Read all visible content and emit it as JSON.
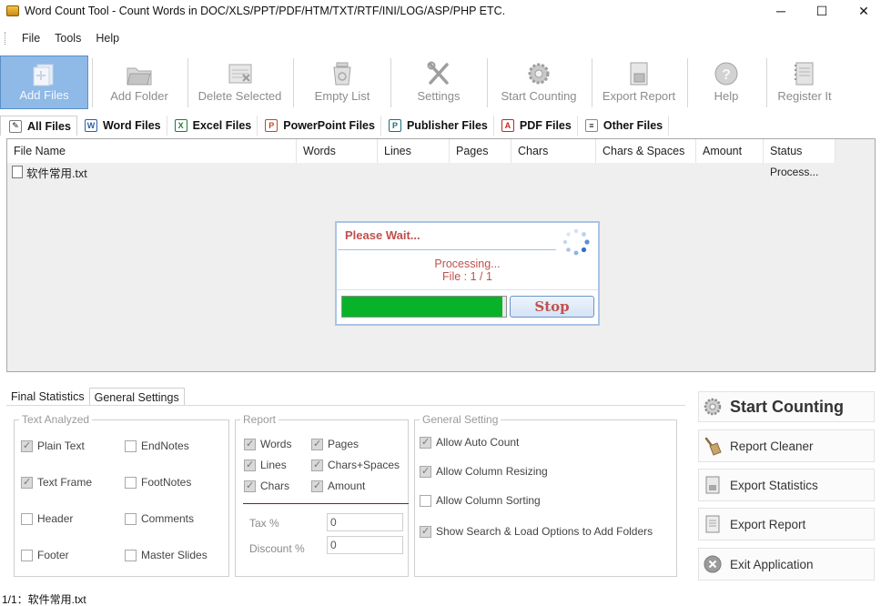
{
  "window": {
    "title": "Word Count Tool - Count Words in DOC/XLS/PPT/PDF/HTM/TXT/RTF/INI/LOG/ASP/PHP ETC.",
    "minimize": "─",
    "maximize": "☐",
    "close": "✕"
  },
  "menu": {
    "items": [
      "File",
      "Tools",
      "Help"
    ]
  },
  "toolbar": {
    "add_files": "Add Files",
    "add_folder": "Add Folder",
    "delete_selected": "Delete Selected",
    "empty_list": "Empty List",
    "settings": "Settings",
    "start_counting": "Start Counting",
    "export_report": "Export Report",
    "help": "Help",
    "register_it": "Register It"
  },
  "category_tabs": {
    "all": "All Files",
    "word": "Word Files",
    "excel": "Excel Files",
    "powerpoint": "PowerPoint Files",
    "publisher": "Publisher Files",
    "pdf": "PDF Files",
    "other": "Other Files"
  },
  "file_list": {
    "columns": [
      "File Name",
      "Words",
      "Lines",
      "Pages",
      "Chars",
      "Chars & Spaces",
      "Amount",
      "Status"
    ],
    "rows": [
      {
        "file_name": "软件常用.txt",
        "status": "Process..."
      }
    ]
  },
  "wait_dialog": {
    "title": "Please Wait...",
    "processing": "Processing...",
    "file_progress": "File : 1 / 1",
    "progress_fraction": 0.98,
    "stop_label": "Stop"
  },
  "bottom_tabs": {
    "final_statistics": "Final Statistics",
    "general_settings": "General Settings"
  },
  "text_analyzed": {
    "legend": "Text Analyzed",
    "plain_text": {
      "label": "Plain Text",
      "checked": true
    },
    "endnotes": {
      "label": "EndNotes",
      "checked": false
    },
    "text_frame": {
      "label": "Text Frame",
      "checked": true
    },
    "footnotes": {
      "label": "FootNotes",
      "checked": false
    },
    "header": {
      "label": "Header",
      "checked": false
    },
    "comments": {
      "label": "Comments",
      "checked": false
    },
    "footer": {
      "label": "Footer",
      "checked": false
    },
    "master_slides": {
      "label": "Master Slides",
      "checked": false
    }
  },
  "report": {
    "legend": "Report",
    "words": {
      "label": "Words",
      "checked": true
    },
    "pages": {
      "label": "Pages",
      "checked": true
    },
    "lines": {
      "label": "Lines",
      "checked": true
    },
    "chars_spaces": {
      "label": "Chars+Spaces",
      "checked": true
    },
    "chars": {
      "label": "Chars",
      "checked": true
    },
    "amount": {
      "label": "Amount",
      "checked": true
    },
    "tax_label": "Tax %",
    "tax_value": "0",
    "discount_label": "Discount %",
    "discount_value": "0"
  },
  "general_setting": {
    "legend": "General Setting",
    "auto_count": {
      "label": "Allow Auto Count",
      "checked": true
    },
    "column_resizing": {
      "label": "Allow Column Resizing",
      "checked": true
    },
    "column_sorting": {
      "label": "Allow Column Sorting",
      "checked": false
    },
    "show_search": {
      "label": "Show Search & Load Options to Add Folders",
      "checked": true
    }
  },
  "actions": {
    "start_counting": "Start Counting",
    "report_cleaner": "Report Cleaner",
    "export_statistics": "Export Statistics",
    "export_report": "Export Report",
    "exit_application": "Exit Application"
  },
  "status_bar": {
    "text": "1/1：软件常用.txt"
  },
  "colors": {
    "accent_red": "#c0504d",
    "progress_green": "#08b32a",
    "active_blue": "#8fb9e6"
  }
}
